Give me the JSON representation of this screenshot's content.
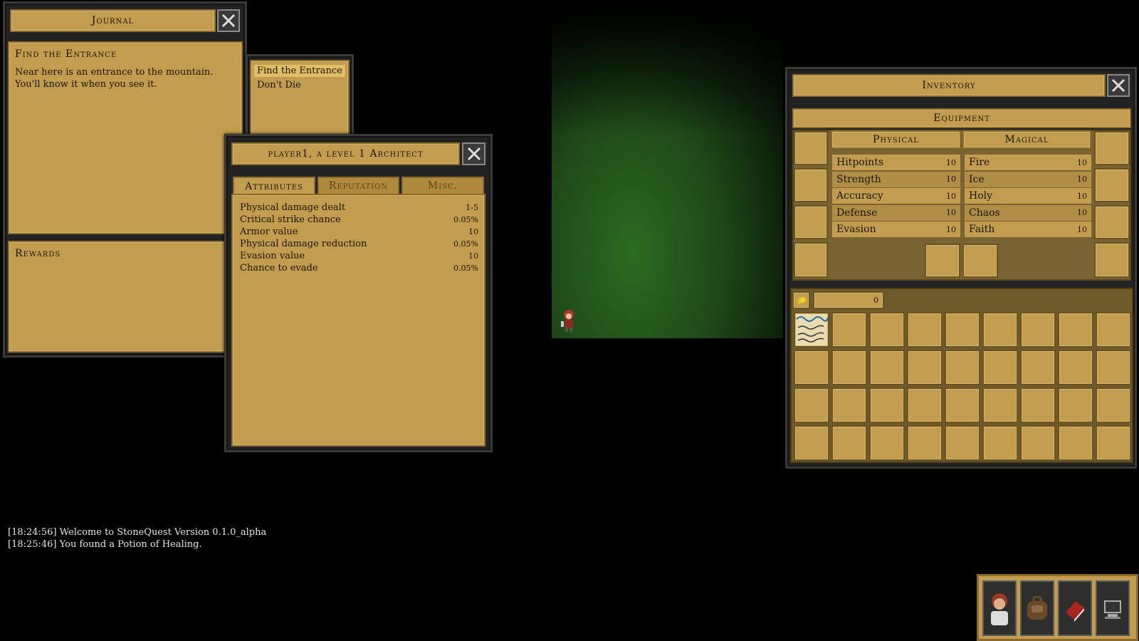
{
  "journal": {
    "title": "Journal",
    "quest_title": "Find the Entrance",
    "quest_text": "Near here is an entrance to the mountain. You'll know it when you see it.",
    "rewards_label": "Rewards",
    "quests": [
      "Find the Entrance",
      "Don't Die"
    ]
  },
  "character": {
    "title": "player1, a level 1 Architect",
    "tabs": [
      "Attributes",
      "Reputation",
      "Misc."
    ],
    "attributes": [
      {
        "label": "Physical damage dealt",
        "value": "1-5"
      },
      {
        "label": "Critical strike chance",
        "value": "0.05%"
      },
      {
        "label": "Armor value",
        "value": "10"
      },
      {
        "label": "Physical damage reduction",
        "value": "0.05%"
      },
      {
        "label": "Evasion value",
        "value": "10"
      },
      {
        "label": "Chance to evade",
        "value": "0.05%"
      }
    ]
  },
  "inventory": {
    "title": "Inventory",
    "equipment_label": "Equipment",
    "physical_label": "Physical",
    "magical_label": "Magical",
    "physical": [
      {
        "label": "Hitpoints",
        "value": "10"
      },
      {
        "label": "Strength",
        "value": "10"
      },
      {
        "label": "Accuracy",
        "value": "10"
      },
      {
        "label": "Defense",
        "value": "10"
      },
      {
        "label": "Evasion",
        "value": "10"
      }
    ],
    "magical": [
      {
        "label": "Fire",
        "value": "10"
      },
      {
        "label": "Ice",
        "value": "10"
      },
      {
        "label": "Holy",
        "value": "10"
      },
      {
        "label": "Chaos",
        "value": "10"
      },
      {
        "label": "Faith",
        "value": "10"
      }
    ],
    "gold": "0",
    "bag_rows": 4,
    "bag_cols": 9
  },
  "log": [
    "[18:24:56] Welcome to StoneQuest Version 0.1.0_alpha",
    "[18:25:46] You found a Potion of Healing."
  ],
  "hotbar": [
    "character-portrait-icon",
    "backpack-icon",
    "journal-book-icon",
    "computer-settings-icon"
  ],
  "colors": {
    "parchment": "#c29d4f",
    "border": "#8a6d2e",
    "grass": "#1f4a18"
  }
}
